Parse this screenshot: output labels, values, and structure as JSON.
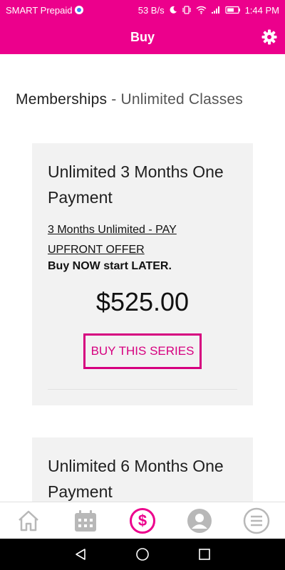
{
  "status_bar": {
    "carrier": "SMART Prepaid",
    "network_speed": "53 B/s",
    "time": "1:44 PM",
    "icons": [
      "shield-icon",
      "moon-icon",
      "vibrate-icon",
      "wifi-icon",
      "signal-icon",
      "battery-icon"
    ]
  },
  "header": {
    "title": "Buy",
    "settings_icon": "gear-icon"
  },
  "section": {
    "heading_main": "Memberships",
    "heading_sub": "- Unlimited Classes"
  },
  "cards": [
    {
      "title": "Unlimited 3 Months One Payment",
      "subtitle": "3 Months Unlimited - PAY UPFRONT OFFER",
      "note": "Buy NOW start LATER.",
      "price": "$525.00",
      "button_label": "BUY THIS SERIES"
    },
    {
      "title": "Unlimited 6 Months One Payment"
    }
  ],
  "bottom_nav": {
    "items": [
      "home-icon",
      "calendar-icon",
      "dollar-icon",
      "profile-icon",
      "menu-icon"
    ],
    "active": "dollar-icon"
  },
  "system_nav": {
    "items": [
      "back-icon",
      "home-circle-icon",
      "recents-icon"
    ]
  },
  "colors": {
    "accent": "#ec008c",
    "button": "#d6007f",
    "card_bg": "#f2f2f2",
    "nav_inactive": "#b8b8b8"
  }
}
